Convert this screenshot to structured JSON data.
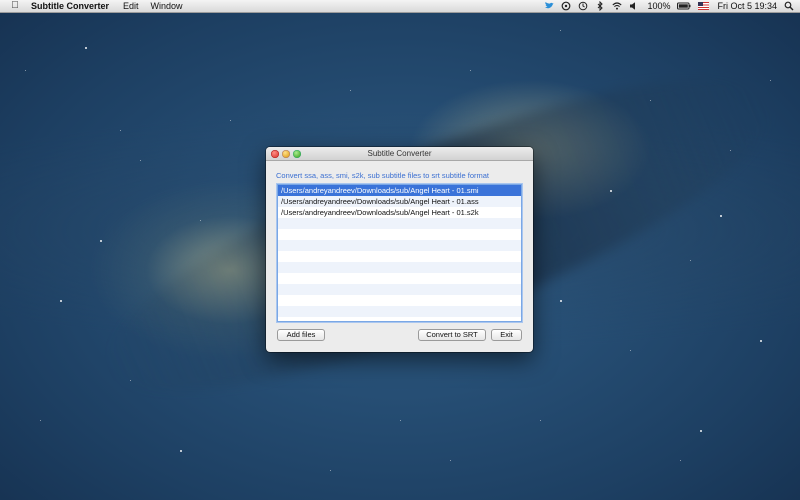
{
  "menubar": {
    "app_name": "Subtitle Converter",
    "menus": [
      "Edit",
      "Window"
    ],
    "battery": "100%",
    "datetime": "Fri Oct 5  19:34"
  },
  "window": {
    "title": "Subtitle Converter",
    "instruction": "Convert ssa, ass, smi, s2k, sub subtitle files to srt subtitle format",
    "files": [
      "/Users/andreyandreev/Downloads/sub/Angel Heart - 01.smi",
      "/Users/andreyandreev/Downloads/sub/Angel Heart - 01.ass",
      "/Users/andreyandreev/Downloads/sub/Angel Heart - 01.s2k"
    ],
    "selected_index": 0,
    "buttons": {
      "add_files": "Add files",
      "convert": "Convert to SRT",
      "exit": "Exit"
    }
  },
  "colors": {
    "accent": "#3a73d9",
    "instruction_text": "#3b6fd1"
  }
}
